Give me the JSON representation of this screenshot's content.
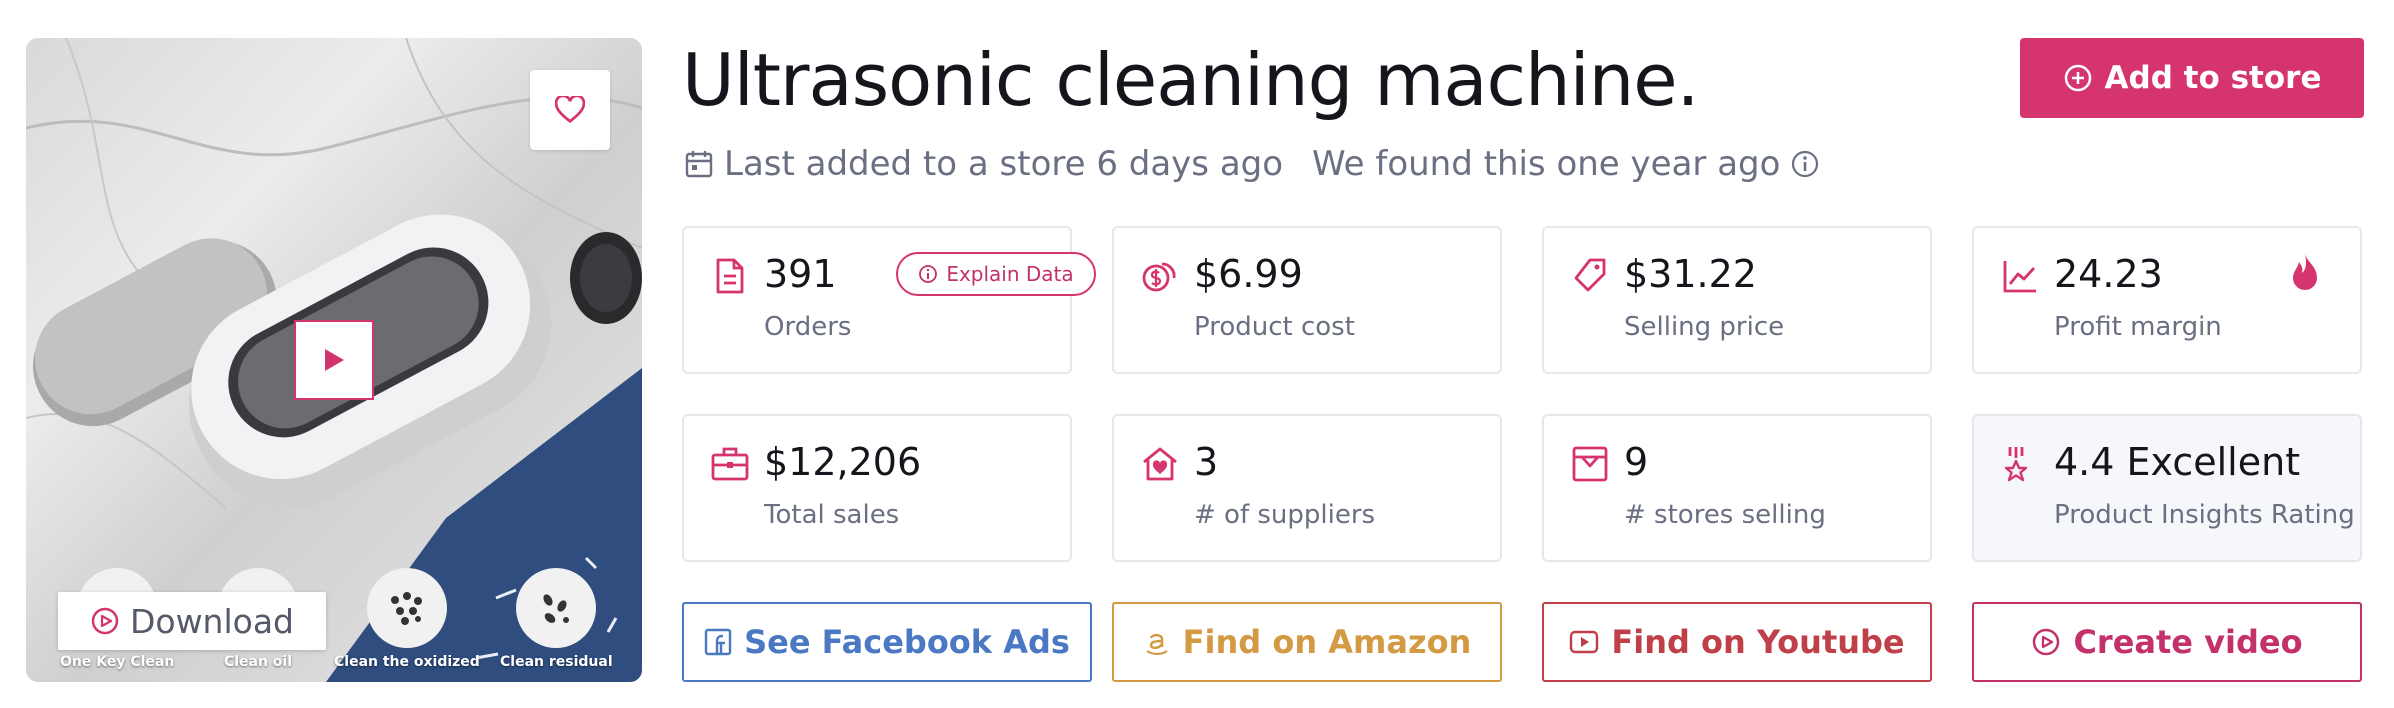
{
  "product": {
    "title": "Ultrasonic cleaning machine.",
    "add_button": "Add to store",
    "last_added": "Last added to a store 6 days ago",
    "found": "We found this one year ago"
  },
  "media": {
    "features": [
      {
        "label": "One Key Clean"
      },
      {
        "label": "Clean oil"
      },
      {
        "label": "Clean the oxidized"
      },
      {
        "label": "Clean residual"
      }
    ],
    "download_label": "Download"
  },
  "stats": {
    "orders": {
      "value": "391",
      "label": "Orders",
      "explain": "Explain Data"
    },
    "product_cost": {
      "value": "$6.99",
      "label": "Product cost"
    },
    "selling_price": {
      "value": "$31.22",
      "label": "Selling price"
    },
    "profit_margin": {
      "value": "24.23",
      "label": "Profit margin"
    },
    "total_sales": {
      "value": "$12,206",
      "label": "Total sales"
    },
    "suppliers": {
      "value": "3",
      "label": "# of suppliers"
    },
    "stores_selling": {
      "value": "9",
      "label": "# stores selling"
    },
    "rating": {
      "value": "4.4 Excellent",
      "label": "Product Insights Rating"
    }
  },
  "actions": {
    "facebook": "See Facebook Ads",
    "amazon": "Find on Amazon",
    "youtube": "Find on Youtube",
    "video": "Create video"
  },
  "colors": {
    "accent": "#d6346f",
    "facebook": "#4a78c2",
    "amazon": "#d39a43",
    "youtube": "#c0404a",
    "muted": "#6a6f82"
  }
}
